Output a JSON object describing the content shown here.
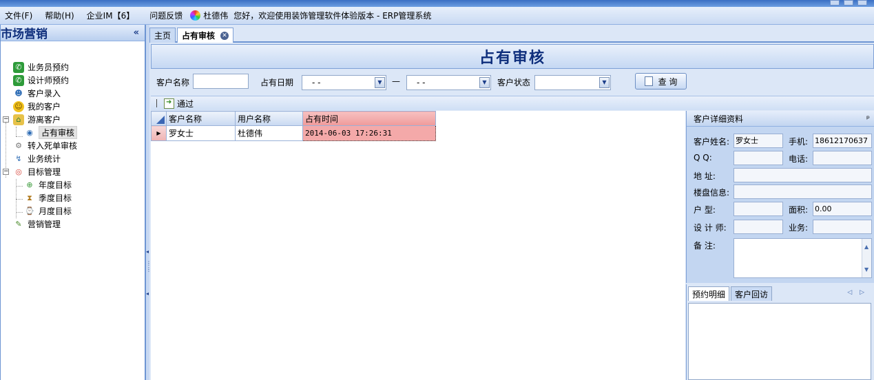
{
  "menu": {
    "file": "文件(F)",
    "help": "帮助(H)",
    "im": "企业IM【6】",
    "feedback": "问题反馈",
    "user": "杜德伟",
    "welcome": "您好，欢迎使用装饰管理软件体验版本 - ERP管理系统"
  },
  "sidebar": {
    "title": "市场营销",
    "collapse": "«",
    "items": [
      {
        "label": "业务员预约",
        "icon": "phone-icon"
      },
      {
        "label": "设计师预约",
        "icon": "phone-icon"
      },
      {
        "label": "客户录入",
        "icon": "user-add-icon"
      },
      {
        "label": "我的客户",
        "icon": "smile-icon"
      },
      {
        "label": "游离客户",
        "icon": "house-icon",
        "expander": "−"
      },
      {
        "label": "占有审核",
        "icon": "circle-icon"
      },
      {
        "label": "转入死单审核",
        "icon": "gear-icon"
      },
      {
        "label": "业务统计",
        "icon": "chart-icon"
      },
      {
        "label": "目标管理",
        "icon": "target-icon",
        "expander": "−"
      },
      {
        "label": "年度目标",
        "icon": "globe-icon"
      },
      {
        "label": "季度目标",
        "icon": "hourglass-icon"
      },
      {
        "label": "月度目标",
        "icon": "calendar-icon"
      },
      {
        "label": "营销管理",
        "icon": "pen-icon"
      }
    ]
  },
  "tabs": {
    "home": "主页",
    "current": "占有审核",
    "close": "✕"
  },
  "page": {
    "title": "占有审核"
  },
  "filters": {
    "customer_name_label": "客户名称",
    "customer_name_value": "",
    "occupy_date_label": "占有日期",
    "date_from": "-   -",
    "date_sep": "—",
    "date_to": "-   -",
    "customer_status_label": "客户状态",
    "customer_status_value": "",
    "search_button": "查 询"
  },
  "toolbar": {
    "approve_label": "通过"
  },
  "grid": {
    "columns": [
      "客户名称",
      "用户名称",
      "占有时间"
    ],
    "rows": [
      [
        "罗女士",
        "杜德伟",
        "2014-06-03 17:26:31"
      ]
    ]
  },
  "detail": {
    "title": "客户详细资料",
    "pin": "ᵖ",
    "fields": {
      "name_label": "客户姓名:",
      "name_value": "罗女士",
      "mobile_label": "手机:",
      "mobile_value": "18612170637",
      "qq_label": "Q    Q:",
      "qq_value": "",
      "phone_label": "电话:",
      "phone_value": "",
      "address_label": "地    址:",
      "address_value": "",
      "building_label": "楼盘信息:",
      "building_value": "",
      "house_type_label": "户    型:",
      "house_type_value": "",
      "area_label": "面积:",
      "area_value": "0.00",
      "designer_label": "设 计 师:",
      "designer_value": "",
      "business_label": "业务:",
      "business_value": "",
      "remark_label": "备    注:",
      "remark_value": ""
    }
  },
  "lower_tabs": {
    "tab1": "预约明细",
    "tab2": "客户回访",
    "nav": "◁ ▷"
  },
  "colors": {
    "accent": "#0e2e7c",
    "selected_header": "#ef9a9a",
    "selected_cell": "#f4a9a9"
  }
}
